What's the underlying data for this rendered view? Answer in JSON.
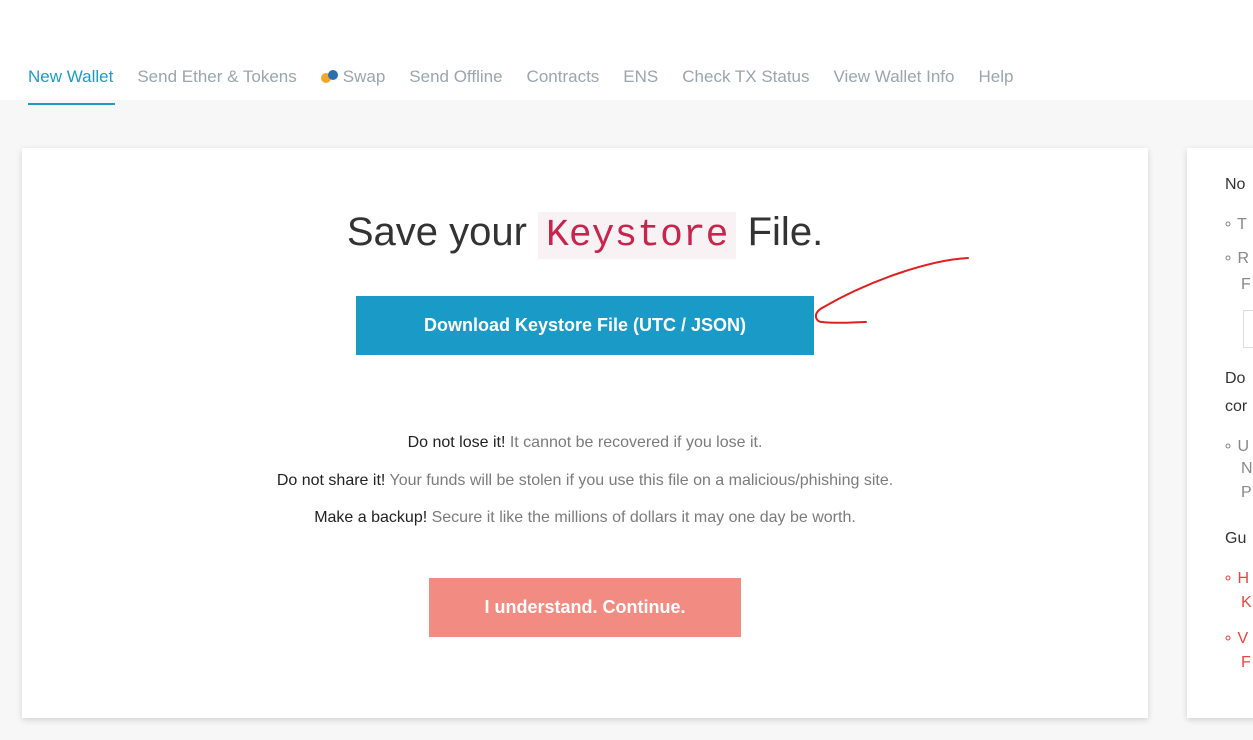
{
  "nav": {
    "items": [
      {
        "label": "New Wallet",
        "active": true
      },
      {
        "label": "Send Ether & Tokens",
        "active": false
      },
      {
        "label": "Swap",
        "active": false,
        "icon": "swap-icon"
      },
      {
        "label": "Send Offline",
        "active": false
      },
      {
        "label": "Contracts",
        "active": false
      },
      {
        "label": "ENS",
        "active": false
      },
      {
        "label": "Check TX Status",
        "active": false
      },
      {
        "label": "View Wallet Info",
        "active": false
      },
      {
        "label": "Help",
        "active": false
      }
    ]
  },
  "main": {
    "title_prefix": "Save your",
    "title_code": "Keystore",
    "title_suffix": "File.",
    "download_button": "Download Keystore File (UTC / JSON)",
    "warnings": [
      {
        "strong": "Do not lose it!",
        "text": " It cannot be recovered if you lose it."
      },
      {
        "strong": "Do not share it!",
        "text": " Your funds will be stolen if you use this file on a malicious/phishing site."
      },
      {
        "strong": "Make a backup!",
        "text": " Secure it like the millions of dollars it may one day be worth."
      }
    ],
    "continue_button": "I understand. Continue."
  },
  "sidebar": {
    "heading1": "No",
    "item1": "T",
    "item2a": "R",
    "item2b": "F",
    "heading2a": "Do",
    "heading2b": "cor",
    "item3a": "U",
    "item3b": "N",
    "item3c": "P",
    "heading3": "Gu",
    "item4a": "H",
    "item4b": "K",
    "item5a": "V",
    "item5b": "F"
  },
  "colors": {
    "accent": "#1a9ac6",
    "continue": "#f28b82",
    "code": "#c7254e",
    "annotation": "#e02020"
  }
}
